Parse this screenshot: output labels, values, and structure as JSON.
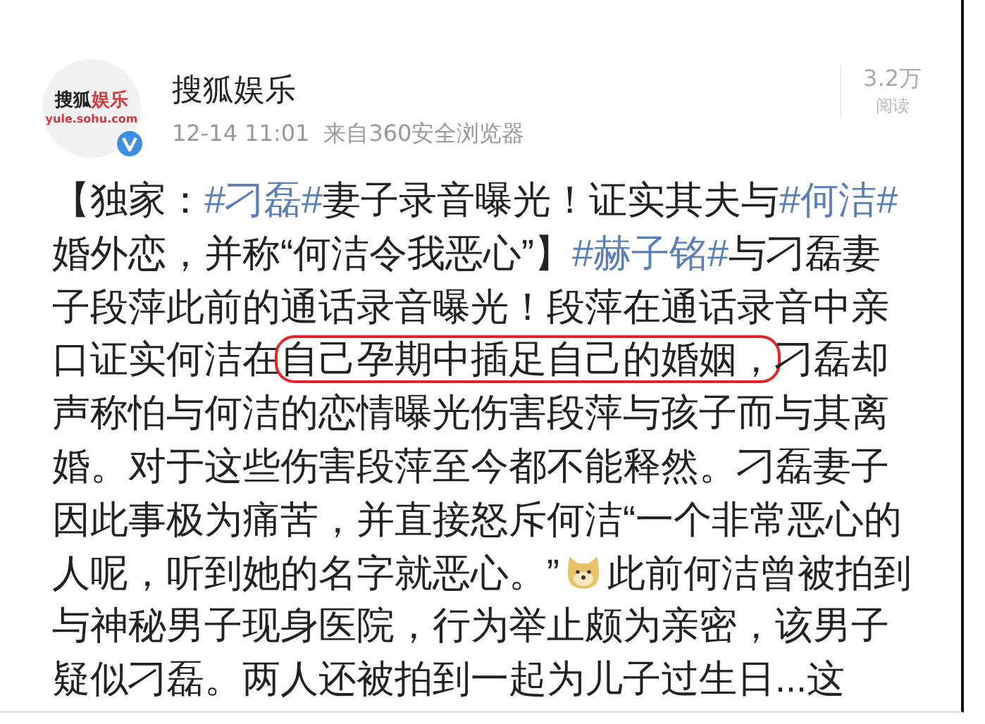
{
  "post": {
    "avatar": {
      "logo_parts": [
        {
          "text": "搜狐",
          "color": "#222222"
        },
        {
          "text": "娱乐",
          "color": "#cf3a43"
        }
      ],
      "domain": "yule.sohu.com",
      "verified": true
    },
    "author": "搜狐娱乐",
    "time": "12-14 11:01",
    "source": "来自360安全浏览器",
    "reads": {
      "count": "3.2万",
      "label": "阅读"
    },
    "body": [
      {
        "kind": "text",
        "text": "【独家："
      },
      {
        "kind": "hashtag",
        "text": "#刁磊#"
      },
      {
        "kind": "text",
        "text": "妻子录音曝光！证实其夫与"
      },
      {
        "kind": "hashtag",
        "text": "#何洁#"
      },
      {
        "kind": "text",
        "text": "婚外恋，并称“何洁令我恶心”】"
      },
      {
        "kind": "hashtag",
        "text": "#赫子铭#"
      },
      {
        "kind": "text",
        "text": "与刁磊妻子段萍此前的通话录音曝光！段萍在通话录音中亲口证实何洁在"
      },
      {
        "kind": "circled",
        "text": "自己孕期中插足自己的婚姻，"
      },
      {
        "kind": "text",
        "text": "刁磊却声称怕与何洁的恋情曝光伤害段萍与孩子而与其离婚。对于这些伤害段萍至今都不能释然。刁磊妻子因此事极为痛苦，并直接怒斥何洁“一个非常恶心的人呢，听到她的名字就恶心。”"
      },
      {
        "kind": "emoji"
      },
      {
        "kind": "text",
        "text": "此前何洁曾被拍到与神秘男子现身医院，行为举止颇为亲密，该男子疑似刁磊。两人还被拍到一起为儿子过生日...这"
      }
    ]
  }
}
